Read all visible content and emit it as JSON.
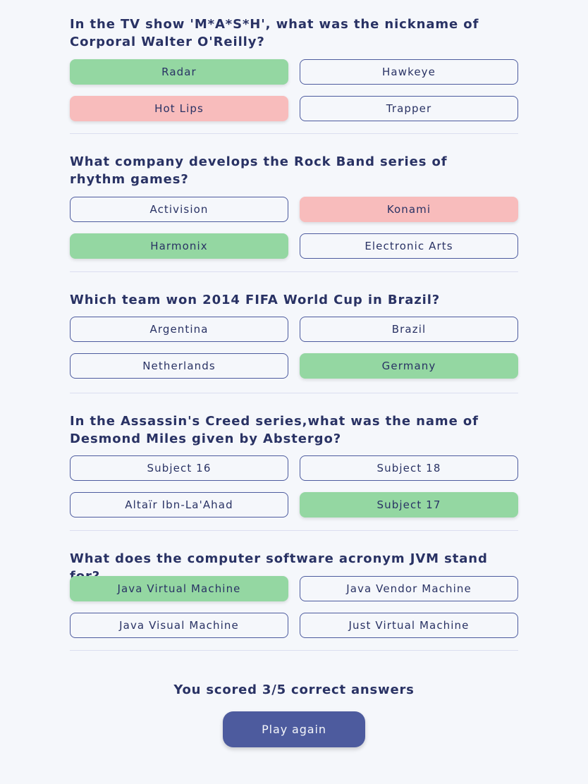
{
  "questions": [
    {
      "text": "In the TV show 'M*A*S*H', what was the nickname of Corporal Walter O'Reilly?",
      "answers": [
        {
          "label": "Radar",
          "state": "correct"
        },
        {
          "label": "Hawkeye",
          "state": "neutral"
        },
        {
          "label": "Hot Lips",
          "state": "incorrect"
        },
        {
          "label": "Trapper",
          "state": "neutral"
        }
      ]
    },
    {
      "text": "What company develops the Rock Band series of rhythm games?",
      "answers": [
        {
          "label": "Activision",
          "state": "neutral"
        },
        {
          "label": "Konami",
          "state": "incorrect"
        },
        {
          "label": "Harmonix",
          "state": "correct"
        },
        {
          "label": "Electronic Arts",
          "state": "neutral"
        }
      ]
    },
    {
      "text": "Which team won 2014 FIFA World Cup in Brazil?",
      "answers": [
        {
          "label": "Argentina",
          "state": "neutral"
        },
        {
          "label": "Brazil",
          "state": "neutral"
        },
        {
          "label": "Netherlands",
          "state": "neutral"
        },
        {
          "label": "Germany",
          "state": "correct"
        }
      ]
    },
    {
      "text": "In the Assassin's Creed series,what was the name of Desmond Miles given by Abstergo?",
      "answers": [
        {
          "label": "Subject 16",
          "state": "neutral"
        },
        {
          "label": "Subject 18",
          "state": "neutral"
        },
        {
          "label": "Altaïr Ibn-La'Ahad",
          "state": "neutral"
        },
        {
          "label": "Subject 17",
          "state": "correct"
        }
      ]
    },
    {
      "text": "What does the computer software acronym JVM stand for?",
      "answers": [
        {
          "label": "Java Virtual Machine",
          "state": "correct"
        },
        {
          "label": "Java Vendor Machine",
          "state": "neutral"
        },
        {
          "label": "Java Visual Machine",
          "state": "neutral"
        },
        {
          "label": "Just Virtual Machine",
          "state": "neutral"
        }
      ]
    }
  ],
  "results": {
    "score_text": "You scored 3/5 correct answers",
    "play_again_label": "Play again"
  },
  "colors": {
    "correct": "#94d7a2",
    "incorrect": "#f8bcbc",
    "primary": "#4d5b9e",
    "text": "#293264",
    "background": "#f5f7fb"
  }
}
